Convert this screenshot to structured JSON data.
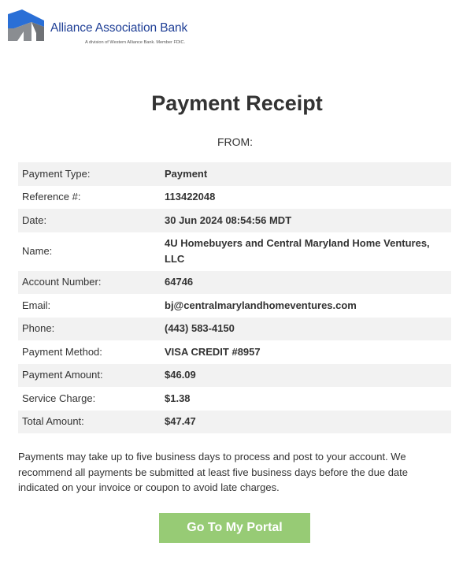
{
  "brand": {
    "name": "Alliance Association Bank",
    "tagline": "A division of Western Alliance Bank. Member FDIC.",
    "logo_icon": "house-roof-logo-icon",
    "colors": {
      "brand_blue": "#1f3f96",
      "mark_blue": "#2a6fd6",
      "mark_gray": "#8a8d91"
    }
  },
  "receipt": {
    "title": "Payment Receipt",
    "from_label": "FROM:",
    "rows": [
      {
        "label": "Payment Type:",
        "value": "Payment"
      },
      {
        "label": "Reference #:",
        "value": "113422048"
      },
      {
        "label": "Date:",
        "value": "30 Jun 2024 08:54:56 MDT"
      },
      {
        "label": "Name:",
        "value": "4U Homebuyers and Central Maryland Home Ventures, LLC"
      },
      {
        "label": "Account Number:",
        "value": "64746"
      },
      {
        "label": "Email:",
        "value": "bj@centralmarylandhomeventures.com"
      },
      {
        "label": "Phone:",
        "value": "(443) 583-4150"
      },
      {
        "label": "Payment Method:",
        "value": "VISA CREDIT #8957"
      },
      {
        "label": "Payment Amount:",
        "value": "$46.09"
      },
      {
        "label": "Service Charge:",
        "value": "$1.38"
      },
      {
        "label": "Total Amount:",
        "value": "$47.47"
      }
    ]
  },
  "note": "Payments may take up to five business days to process and post to your account. We recommend all payments be submitted at least five business days before the due date indicated on your invoice or coupon to avoid late charges.",
  "cta": {
    "label": "Go To My Portal",
    "color": "#97cb75"
  }
}
